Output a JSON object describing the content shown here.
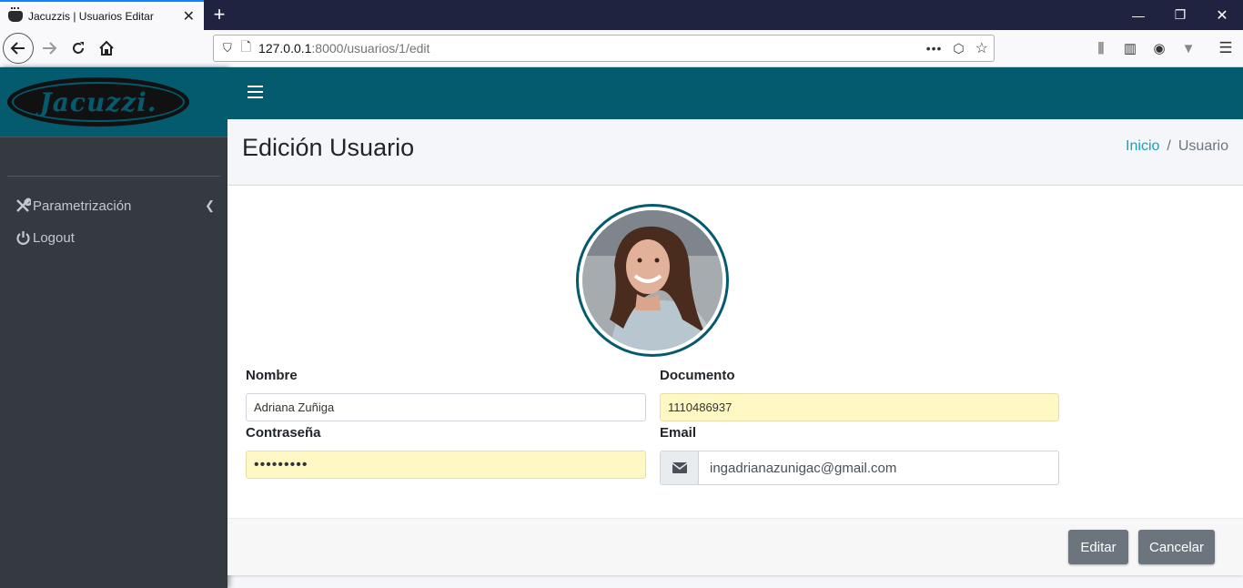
{
  "browser": {
    "tab_title": "Jacuzzis | Usuarios Editar",
    "url_host": "127.0.0.1",
    "url_rest": ":8000/usuarios/1/edit"
  },
  "sidebar": {
    "logo_text": "Jacuzzi.",
    "items": [
      {
        "label": "Parametrización",
        "icon": "wrench-tools-icon"
      },
      {
        "label": "Logout",
        "icon": "power-icon"
      }
    ]
  },
  "header": {
    "title": "Edición Usuario",
    "breadcrumb": {
      "home": "Inicio",
      "separator": "/",
      "current": "Usuario"
    }
  },
  "form": {
    "nombre_label": "Nombre",
    "nombre_value": "Adriana Zuñiga",
    "documento_label": "Documento",
    "documento_value": "1110486937",
    "password_label": "Contraseña",
    "password_value": "•••••••••",
    "email_label": "Email",
    "email_value": "ingadrianazunigac@gmail.com"
  },
  "buttons": {
    "edit": "Editar",
    "cancel": "Cancelar"
  },
  "colors": {
    "primary": "#055b6e",
    "sidebar": "#343a40",
    "button": "#6c757d",
    "link": "#17a2b8"
  }
}
